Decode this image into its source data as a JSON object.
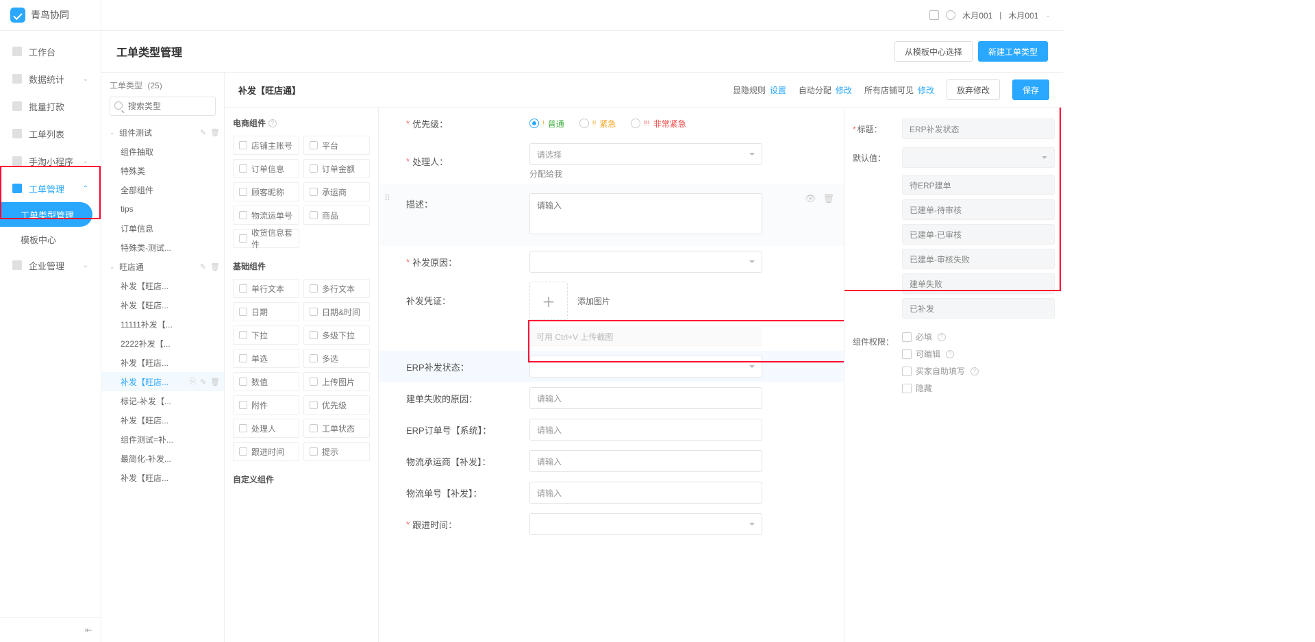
{
  "brand": "青鸟协同",
  "user": {
    "name": "木月001",
    "sep": "|",
    "alt": "木月001"
  },
  "nav": {
    "workbench": "工作台",
    "stats": "数据统计",
    "refund": "批量打款",
    "orders": "工单列表",
    "taobao": "手淘小程序",
    "workorder": "工单管理",
    "template": "模板中心",
    "enterprise": "企业管理",
    "type_mgmt": "工单类型管理"
  },
  "page": {
    "title": "工单类型管理",
    "btn_from_template": "从模板中心选择",
    "btn_new_type": "新建工单类型"
  },
  "typelist": {
    "heading": "工单类型",
    "count": "(25)",
    "search_placeholder": "搜索类型",
    "groups": [
      {
        "name": "组件测试",
        "items": [
          "组件抽取",
          "特殊类",
          "全部组件",
          "tips",
          "订单信息",
          "特殊类-测试..."
        ]
      },
      {
        "name": "旺店通",
        "items": [
          "补发【旺店...",
          "补发【旺店...",
          "11111补发【...",
          "2222补发【...",
          "补发【旺店...",
          "补发【旺店...",
          "标记-补发【...",
          "补发【旺店...",
          "组件测试=补...",
          "最简化-补发...",
          "补发【旺店..."
        ]
      }
    ],
    "current_index": 5
  },
  "editor": {
    "title": "补发【旺店通】",
    "actions": {
      "visibility": "显隐规则",
      "visibility_link": "设置",
      "auto_assign": "自动分配",
      "modify": "修改",
      "shops": "所有店铺可见",
      "discard": "放弃修改",
      "save": "保存"
    }
  },
  "palette": {
    "g1": "电商组件",
    "g1_items": [
      "店铺主账号",
      "平台",
      "订单信息",
      "订单金额",
      "顾客昵称",
      "承运商",
      "物流运单号",
      "商品",
      "收货信息套件"
    ],
    "g2": "基础组件",
    "g2_items": [
      "单行文本",
      "多行文本",
      "日期",
      "日期&时间",
      "下拉",
      "多级下拉",
      "单选",
      "多选",
      "数值",
      "上传图片",
      "附件",
      "优先级",
      "处理人",
      "工单状态",
      "跟进时间",
      "提示"
    ],
    "g3": "自定义组件"
  },
  "form": {
    "priority_label": "优先级：",
    "priority_opts": {
      "normal": "普通",
      "urgent": "紧急",
      "very": "非常紧急"
    },
    "handler": "处理人：",
    "handler_placeholder": "请选择",
    "assign_to_me": "分配给我",
    "desc": "描述：",
    "desc_placeholder": "请输入",
    "reason": "补发原因：",
    "voucher": "补发凭证：",
    "add_image": "添加图片",
    "paste_hint": "可用 Ctrl+V 上传截图",
    "erp_status": "ERP补发状态：",
    "fail_reason": "建单失败的原因：",
    "fail_reason_ph": "请输入",
    "erp_order": "ERP订单号【系统】：",
    "erp_order_ph": "请输入",
    "carrier": "物流承运商【补发】：",
    "carrier_ph": "请输入",
    "tracking": "物流单号【补发】：",
    "tracking_ph": "请输入",
    "follow": "跟进时间："
  },
  "props": {
    "title_label": "标题：",
    "title_value": "ERP补发状态",
    "default_label": "默认值：",
    "options": [
      "待ERP建单",
      "已建单-待审核",
      "已建单-已审核",
      "已建单-审核失败",
      "建单失败",
      "已补发"
    ],
    "perm_label": "组件权限：",
    "perm_items": [
      "必填",
      "可编辑",
      "买家自助填写",
      "隐藏"
    ]
  }
}
